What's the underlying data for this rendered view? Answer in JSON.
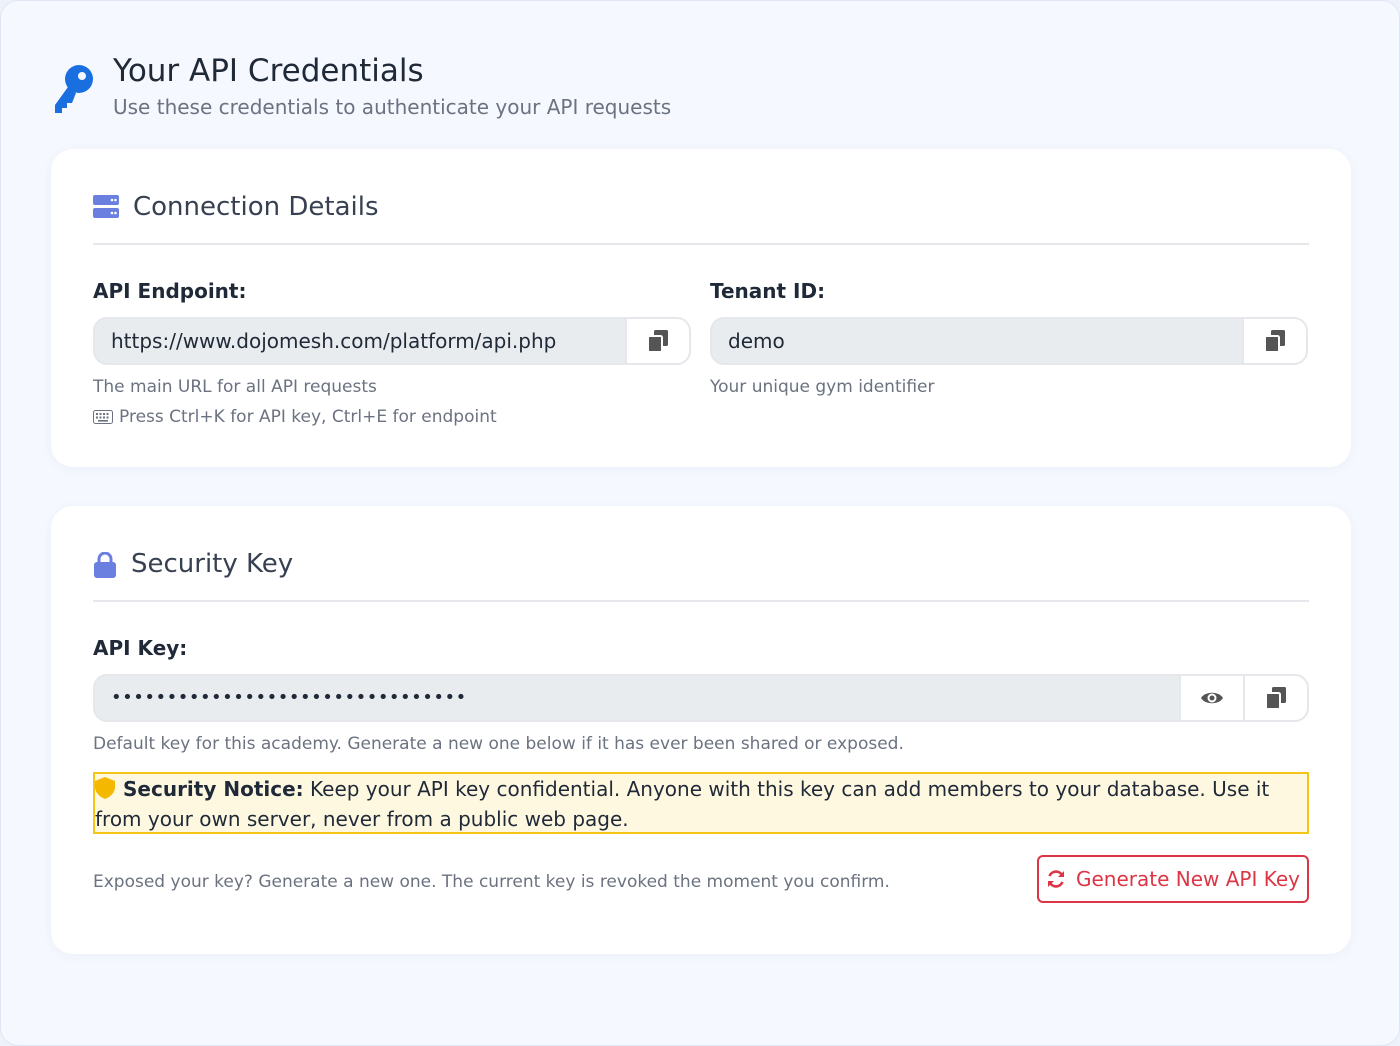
{
  "header": {
    "title": "Your API Credentials",
    "subtitle": "Use these credentials to authenticate your API requests"
  },
  "connection": {
    "title": "Connection Details",
    "endpoint": {
      "label": "API Endpoint:",
      "value": "https://www.dojomesh.com/platform/api.php",
      "hint": "The main URL for all API requests",
      "shortcut_hint": "Press Ctrl+K for API key, Ctrl+E for endpoint"
    },
    "tenant": {
      "label": "Tenant ID:",
      "value": "demo",
      "hint": "Your unique gym identifier"
    }
  },
  "security": {
    "title": "Security Key",
    "api_key": {
      "label": "API Key:",
      "masked_value": "••••••••••••••••••••••••••••••••",
      "hint": "Default key for this academy. Generate a new one below if it has ever been shared or exposed."
    },
    "notice": {
      "title": "Security Notice:",
      "text": " Keep your API key confidential. Anyone with this key can add members to your database. Use it from your own server, never from a public web page."
    },
    "regen_text": "Exposed your key? Generate a new one. The current key is revoked the moment you confirm.",
    "regen_button": "Generate New API Key"
  },
  "colors": {
    "accent_blue": "#1a6fe0",
    "icon_purple": "#6a7fe0",
    "danger": "#dc3545",
    "warning": "#f5c518"
  },
  "icons": [
    "key-icon",
    "server-icon",
    "copy-icon",
    "keyboard-icon",
    "lock-icon",
    "eye-icon",
    "shield-icon",
    "refresh-icon"
  ]
}
